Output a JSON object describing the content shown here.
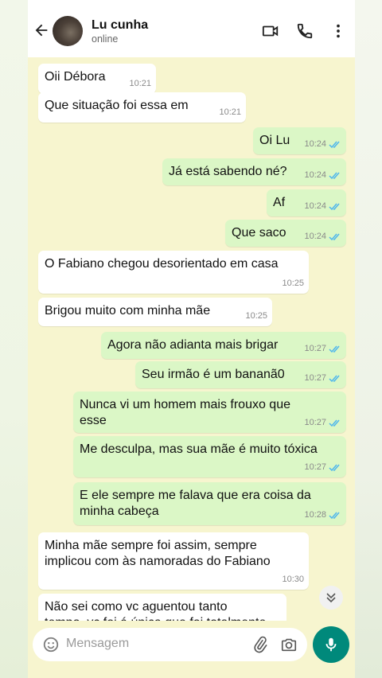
{
  "contact": {
    "name": "Lu cunha",
    "status": "online"
  },
  "messages": [
    {
      "dir": "in",
      "text": "Oii Débora",
      "time": "10:21"
    },
    {
      "dir": "in",
      "text": "Que situação foi essa em",
      "time": "10:21"
    },
    {
      "dir": "out",
      "text": "Oi Lu",
      "time": "10:24"
    },
    {
      "dir": "out",
      "text": "Já está sabendo né?",
      "time": "10:24"
    },
    {
      "dir": "out",
      "text": "Af",
      "time": "10:24"
    },
    {
      "dir": "out",
      "text": "Que saco",
      "time": "10:24"
    },
    {
      "dir": "in",
      "text": "O Fabiano chegou desorientado em casa",
      "time": "10:25"
    },
    {
      "dir": "in",
      "text": "Brigou muito com minha mãe",
      "time": "10:25"
    },
    {
      "dir": "out",
      "text": "Agora não adianta mais brigar",
      "time": "10:27"
    },
    {
      "dir": "out",
      "text": "Seu irmão é um bananã0",
      "time": "10:27"
    },
    {
      "dir": "out",
      "text": "Nunca vi um homem mais frouxo que\nesse",
      "time": "10:27"
    },
    {
      "dir": "out",
      "text": "Me desculpa, mas sua mãe é muito tóxica",
      "time": "10:27"
    },
    {
      "dir": "out",
      "text": "E ele sempre me falava que era coisa da\nminha cabeça",
      "time": "10:28"
    },
    {
      "dir": "in",
      "text": "Minha mãe sempre foi assim, sempre\nimplicou com às namoradas do Fabiano",
      "time": "10:30"
    },
    {
      "dir": "in",
      "text": "Não sei como vc aguentou tanto\ntempo, vc foi á única que foi totalmente",
      "time": ""
    }
  ],
  "composer": {
    "placeholder": "Mensagem"
  },
  "colors": {
    "chat_bg": "#f7f5cf",
    "outgoing_bubble": "#dbf7c6",
    "incoming_bubble": "#ffffff",
    "read_tick": "#4fb6ec",
    "mic_button": "#00897b"
  },
  "icons": [
    "back-arrow-icon",
    "video-call-icon",
    "phone-icon",
    "more-vert-icon",
    "chevrons-down-icon",
    "emoji-icon",
    "attach-icon",
    "camera-icon",
    "mic-icon"
  ]
}
